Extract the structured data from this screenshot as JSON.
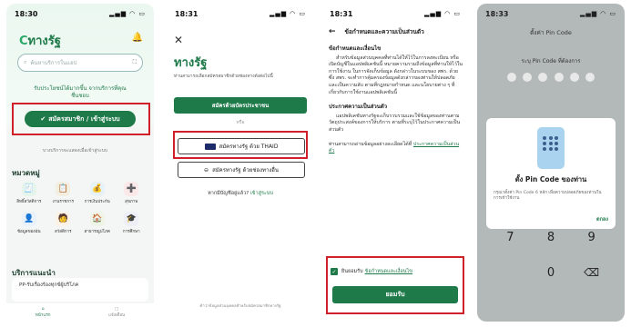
{
  "phone1": {
    "time": "18:30",
    "logo_mark": "C",
    "logo_text": "ทางรัฐ",
    "bell_icon": "bell-icon",
    "search_placeholder": "ค้นหาบริการในแอป",
    "promo_line1": "รับประโยชน์ได้มากขึ้น จากบริการที่คุณ",
    "promo_line2": "ชื่นชอบ",
    "register_label": "สมัครสมาชิก / เข้าสู่ระบบ",
    "notice": "บางบริการจะแสดงเมื่อเข้าสู่ระบบ",
    "categories_title": "หมวดหมู่",
    "categories": [
      {
        "label": "สิทธิ์สวัสดิการ",
        "icon": "🧾",
        "bg": "#e6f5ec"
      },
      {
        "label": "งานราชการ",
        "icon": "📋",
        "bg": "#f3efe0"
      },
      {
        "label": "การเงินประกัน",
        "icon": "💰",
        "bg": "#e6f1f8"
      },
      {
        "label": "สุขภาพ",
        "icon": "➕",
        "bg": "#fbe8e8"
      },
      {
        "label": "ข้อมูลของฉัน",
        "icon": "👤",
        "bg": "#e9f1fa"
      },
      {
        "label": "สวัสดิการ",
        "icon": "🧑",
        "bg": "#fbf1e4"
      },
      {
        "label": "สาธารณูปโภค",
        "icon": "🏠",
        "bg": "#eef5e6"
      },
      {
        "label": "การศึกษา",
        "icon": "🎓",
        "bg": "#eeeef6"
      }
    ],
    "services_title": "บริการแนะนำ",
    "service_card": "PP-รับเรื่องร้องทุกข์ผู้บริโภค",
    "nav_home": "หน้าแรก",
    "nav_other": "แจ้งเตือน"
  },
  "phone2": {
    "time": "18:31",
    "close_icon": "close-icon",
    "title": "ทางรัฐ",
    "desc": "ท่านสามารถเลือกสมัครสมาชิกด้วยช่องทางดังต่อไปนี้",
    "btn_register_id": "สมัครด้วยบัตรประชาชน",
    "or_label": "หรือ",
    "btn_thaid": "สมัครทางรัฐ ด้วย THAID",
    "btn_other": "สมัครทางรัฐ ด้วยช่องทางอื่น",
    "login_prompt": "หากมีบัญชีอยู่แล้ว?",
    "login_link": "เข้าสู่ระบบ",
    "footer": "คำว่าข้อมูลส่วนบุคคลสำหรับสมัครสมาชิกทางรัฐ"
  },
  "phone3": {
    "time": "18:31",
    "header": "ข้อกำหนดและความเป็นส่วนตัว",
    "section1_title": "ข้อกำหนดและเงื่อนไข",
    "section1_text": "สำหรับข้อมูลส่วนบุคคลที่ท่านได้ให้ไว้ในการลงทะเบียน หรือเปิดบัญชีในแอปพลิเคชันนี้ หมายความรวมถึงข้อมูลที่ท่านให้ไว้ในการใช้งาน ในการจัดเก็บข้อมูล ดังกล่าวในระบบของ สพร. ด้วย ซึ่ง สพร. จะทำการคุ้มครองข้อมูลดังกล่าวของท่านให้ปลอดภัยและเป็นความลับ ตามที่กฎหมายกำหนด และนโยบายต่าง ๆ ที่เกี่ยวกับการใช้งานแอปพลิเคชันนี้",
    "section2_title": "ประกาศความเป็นส่วนตัว",
    "section2_text": "แอปพลิเคชันทางรัฐจะเก็บรวบรวมและใช้ข้อมูลของท่านตามวัตถุประสงค์ของการให้บริการ ตามที่ระบุไว้ในประกาศความเป็นส่วนตัว",
    "section2_more": "ท่านสามารถอ่านข้อมูลอย่างละเอียดได้ที่",
    "section2_link": "ประกาศความเป็นส่วนตัว",
    "consent_prefix": "ยินยอมรับ",
    "consent_link": "ข้อกำหนดและเงื่อนไข",
    "accept_label": "ยอมรับ"
  },
  "phone4": {
    "time": "18:33",
    "header": "ตั้งค่า Pin Code",
    "subheader": "ระบุ Pin Code ที่ต้องการ",
    "modal_title": "ตั้ง Pin Code ของท่าน",
    "modal_desc": "กรุณาตั้งค่า Pin Code 6 หลัก เพื่อความปลอดภัยของท่านในการเข้าใช้งาน",
    "modal_ok": "ตกลง",
    "keys": [
      "7",
      "8",
      "9",
      "",
      "0",
      "⌫"
    ]
  }
}
